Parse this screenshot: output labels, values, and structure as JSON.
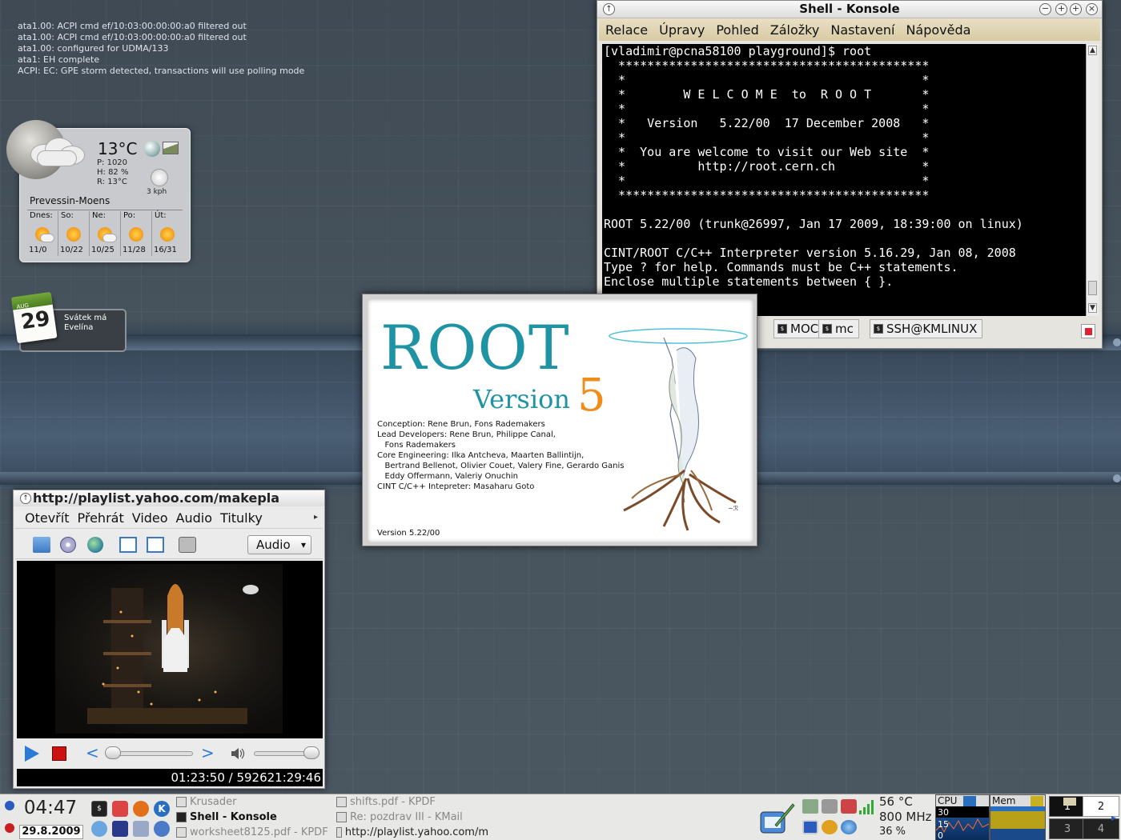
{
  "kernel_log": [
    "ata1.00: ACPI cmd ef/10:03:00:00:00:a0 filtered out",
    "ata1.00: ACPI cmd ef/10:03:00:00:00:a0 filtered out",
    "ata1.00: configured for UDMA/133",
    "ata1: EH complete",
    "ACPI: EC: GPE storm detected, transactions will use polling mode"
  ],
  "weather": {
    "temperature": "13°C",
    "pressure": "P:  1020",
    "humidity": "H:  82 %",
    "realfeel": "R:  13°C",
    "wind": "3 kph",
    "city": "Prevessin-Moens",
    "forecast": [
      {
        "day": "Dnes:",
        "temps": "11/0",
        "icon": "partly-cloudy-icon"
      },
      {
        "day": "So:",
        "temps": "10/22",
        "icon": "sun-icon"
      },
      {
        "day": "Ne:",
        "temps": "10/25",
        "icon": "partly-cloudy-icon"
      },
      {
        "day": "Po:",
        "temps": "11/28",
        "icon": "sun-icon"
      },
      {
        "day": "Út:",
        "temps": "16/31",
        "icon": "sun-icon"
      }
    ]
  },
  "calendar": {
    "month": "AUG",
    "day": "29",
    "line1": "Svátek má",
    "line2": "Evelína"
  },
  "konsole": {
    "title": "Shell - Konsole",
    "menu": [
      "Relace",
      "Úpravy",
      "Pohled",
      "Záložky",
      "Nastavení",
      "Nápověda"
    ],
    "lines": [
      "[vladimir@pcna58100 playground]$ root",
      "  *******************************************",
      "  *                                         *",
      "  *        W E L C O M E  to  R O O T       *",
      "  *                                         *",
      "  *   Version   5.22/00  17 December 2008   *",
      "  *                                         *",
      "  *  You are welcome to visit our Web site  *",
      "  *          http://root.cern.ch            *",
      "  *                                         *",
      "  *******************************************",
      "",
      "ROOT 5.22/00 (trunk@26997, Jan 17 2009, 18:39:00 on linux)",
      "",
      "CINT/ROOT C/C++ Interpreter version 5.16.29, Jan 08, 2008",
      "Type ? for help. Commands must be C++ statements.",
      "Enclose multiple statements between { }."
    ],
    "tabs": [
      "MOC",
      "mc",
      "SSH@KMLINUX"
    ]
  },
  "splash": {
    "title": "ROOT",
    "version_word": "Version",
    "version_num": "5",
    "credits": [
      "Conception: Rene Brun, Fons Rademakers",
      "",
      "Lead Developers: Rene Brun, Philippe Canal,",
      "   Fons Rademakers",
      "",
      "Core Engineering: Ilka Antcheva, Maarten Ballintijn,",
      "   Bertrand Bellenot, Olivier Couet, Valery Fine, Gerardo Ganis",
      "   Eddy Offermann, Valeriy Onuchin",
      "",
      "CINT C/C++ Intepreter: Masaharu Goto"
    ],
    "version_line": "Version 5.22/00"
  },
  "player": {
    "title": "http://playlist.yahoo.com/makepla",
    "menu": [
      "Otevřít",
      "Přehrát",
      "Video",
      "Audio",
      "Titulky"
    ],
    "audio_select": "Audio",
    "status_time": "01:23:50 / 592621:29:46"
  },
  "taskbar": {
    "clock": "04:47",
    "date": "29.8.2009",
    "tasks": [
      {
        "label": "Krusader",
        "active": false
      },
      {
        "label": "Shell - Konsole",
        "active": true
      },
      {
        "label": "worksheet8125.pdf - KPDF",
        "active": false
      },
      {
        "label": "shifts.pdf - KPDF",
        "active": false
      },
      {
        "label": "Re: pozdrav III - KMail",
        "active": false
      },
      {
        "label": "http://playlist.yahoo.com/m",
        "active": false
      }
    ],
    "temp": "56  °C",
    "freq": "800 MHz",
    "percent": "36 %",
    "cpu_label": "CPU",
    "mem_label": "Mem",
    "cpu_ticks": [
      "30",
      "15",
      "0"
    ],
    "pager": [
      "1",
      "2",
      "3",
      "4"
    ]
  }
}
